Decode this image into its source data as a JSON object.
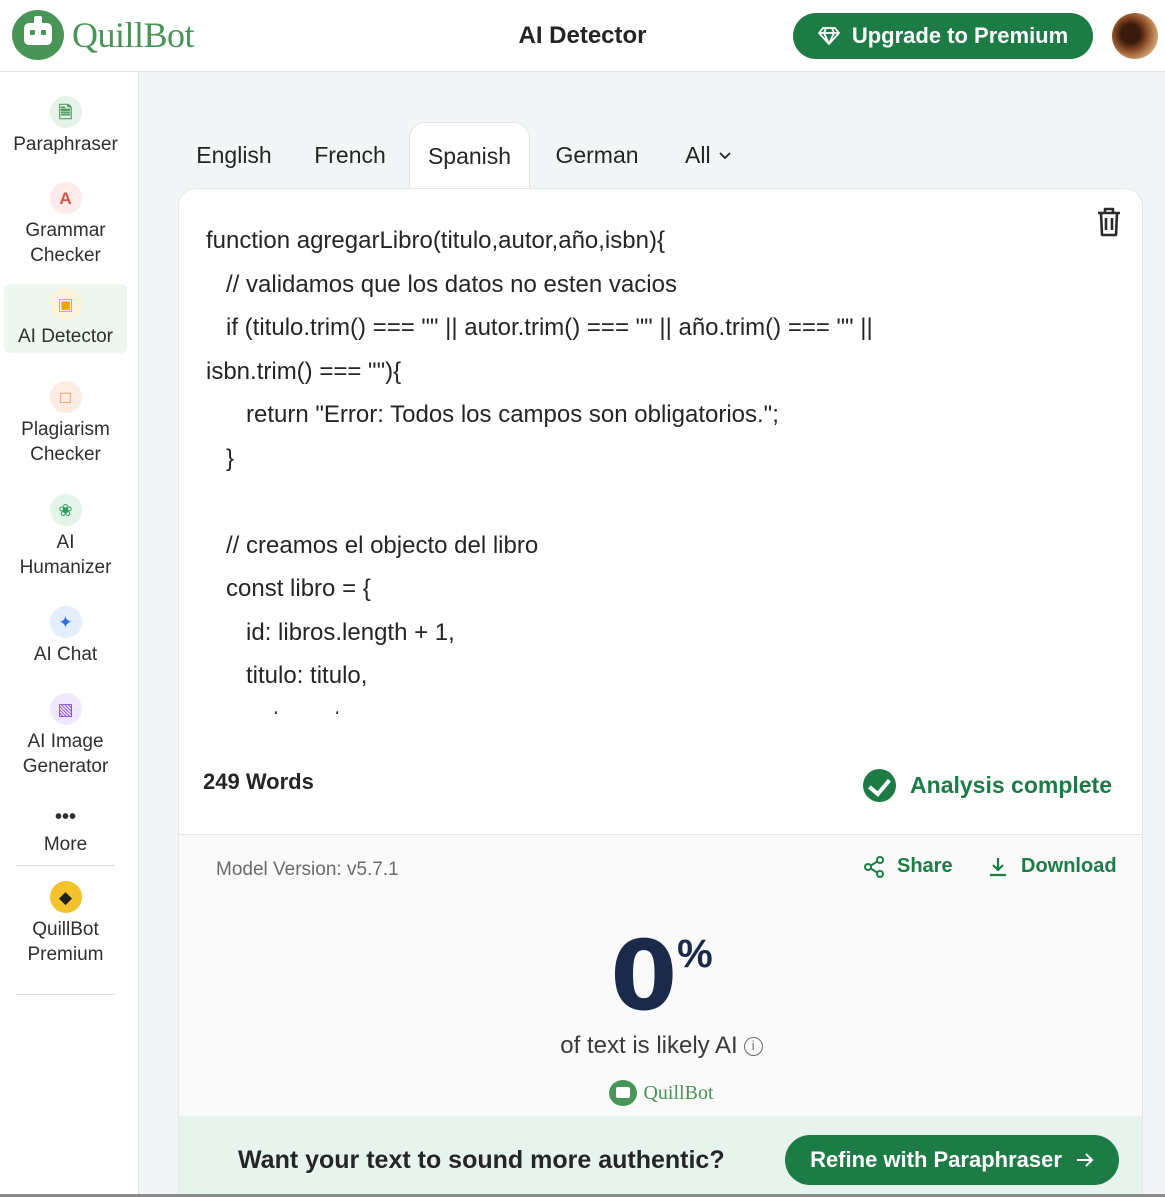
{
  "header": {
    "logo_text": "QuillBot",
    "page_title": "AI Detector",
    "upgrade_label": "Upgrade to Premium"
  },
  "sidebar": {
    "items": [
      {
        "label": "Paraphraser",
        "icon": "paraphraser-icon",
        "color": "#499557",
        "bg": "#e6f3ea",
        "active": false
      },
      {
        "label": "Grammar Checker",
        "icon": "grammar-checker-icon",
        "color": "#e0524a",
        "bg": "#fdeaea",
        "active": false
      },
      {
        "label": "AI Detector",
        "icon": "ai-detector-icon",
        "color": "#f0a21a",
        "bg": "#fef3dd",
        "active": true
      },
      {
        "label": "Plagiarism Checker",
        "icon": "plagiarism-checker-icon",
        "color": "#f27a3a",
        "bg": "#feece2",
        "active": false
      },
      {
        "label": "AI Humanizer",
        "icon": "ai-humanizer-icon",
        "color": "#2e9a5c",
        "bg": "#e3f4ea",
        "active": false
      },
      {
        "label": "AI Chat",
        "icon": "ai-chat-icon",
        "color": "#2f6fdc",
        "bg": "#e4edfc",
        "active": false
      },
      {
        "label": "AI Image Generator",
        "icon": "ai-image-generator-icon",
        "color": "#8a4fd6",
        "bg": "#f0e8fb",
        "active": false
      },
      {
        "label": "More",
        "icon": "more-icon",
        "color": "#2f2f2f",
        "bg": "transparent",
        "active": false
      },
      {
        "label": "QuillBot Premium",
        "icon": "diamond-icon",
        "color": "#1f1f1f",
        "bg": "#f3c22c",
        "active": false
      }
    ]
  },
  "tabs": {
    "items": [
      "English",
      "French",
      "Spanish",
      "German",
      "All"
    ],
    "active": "Spanish"
  },
  "editor": {
    "lines": [
      "function agregarLibro(titulo,autor,año,isbn){",
      "   // validamos que los datos no esten vacios",
      "   if (titulo.trim() === \"\" || autor.trim() === \"\" || año.trim() === \"\" ||",
      "isbn.trim() === \"\"){",
      "      return \"Error: Todos los campos son obligatorios.\";",
      "   }",
      "",
      "   // creamos el objecto del libro",
      "   const libro = {",
      "      id: libros.length + 1,",
      "      titulo: titulo,",
      "      autor:autor,"
    ]
  },
  "footer": {
    "word_count": "249 Words",
    "status": "Analysis complete"
  },
  "results": {
    "model_version": "Model Version: v5.7.1",
    "share_label": "Share",
    "download_label": "Download",
    "score": "0",
    "score_unit": "%",
    "score_caption": "of text is likely AI",
    "brand": "QuillBot"
  },
  "cta": {
    "text": "Want your text to sound more authentic?",
    "button_label": "Refine with Paraphraser"
  },
  "colors": {
    "brand_green": "#499557",
    "action_green": "#1d7c46",
    "score_navy": "#1b2a4a",
    "cta_bg": "#e7f4ee"
  }
}
